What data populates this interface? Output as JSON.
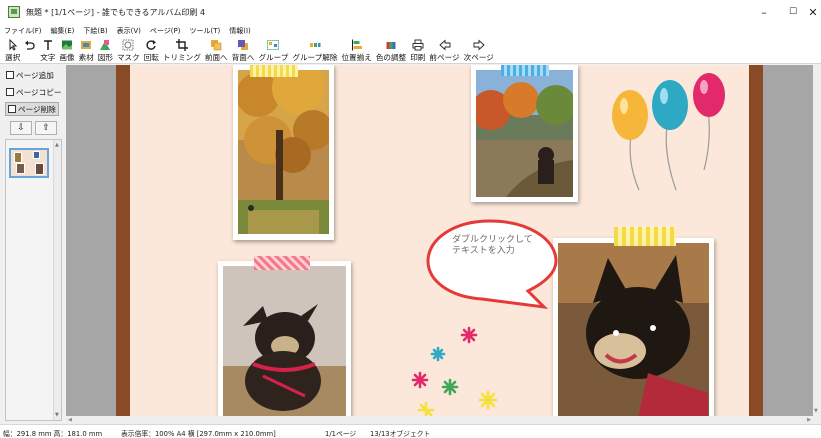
{
  "window": {
    "title": "無題 * [1/1ページ] - 誰でもできるアルバム印刷 4",
    "minimize": "–",
    "maximize": "☐",
    "close": "✕"
  },
  "menu": [
    "ファイル(F)",
    "編集(E)",
    "下絵(B)",
    "表示(V)",
    "ページ(P)",
    "ツール(T)",
    "情報(I)"
  ],
  "toolbar": [
    {
      "label": "選択",
      "icon": "cursor-icon"
    },
    {
      "label": "",
      "icon": "undo-icon"
    },
    {
      "label": "文字",
      "icon": "text-icon"
    },
    {
      "label": "画像",
      "icon": "image-icon"
    },
    {
      "label": "素材",
      "icon": "material-icon"
    },
    {
      "label": "図形",
      "icon": "shape-icon"
    },
    {
      "label": "マスク",
      "icon": "mask-icon"
    },
    {
      "label": "回転",
      "icon": "rotate-icon"
    },
    {
      "label": "トリミング",
      "icon": "trim-icon"
    },
    {
      "label": "前面へ",
      "icon": "bring-front-icon"
    },
    {
      "label": "背面へ",
      "icon": "send-back-icon"
    },
    {
      "label": "グループ",
      "icon": "group-icon"
    },
    {
      "label": "グループ解除",
      "icon": "ungroup-icon"
    },
    {
      "label": "位置揃え",
      "icon": "align-icon"
    },
    {
      "label": "色の調整",
      "icon": "color-adjust-icon"
    },
    {
      "label": "印刷",
      "icon": "print-icon"
    },
    {
      "label": "前ページ",
      "icon": "prev-page-icon"
    },
    {
      "label": "次ページ",
      "icon": "next-page-icon"
    }
  ],
  "side": {
    "add": "ページ追加",
    "copy": "ページコピー",
    "delete": "ページ削除",
    "down": "⇩",
    "up": "⇧"
  },
  "canvas": {
    "bubble_text": "ダブルクリックして\nテキストを入力"
  },
  "status": {
    "size": "幅：291.8 mm  高：181.0 mm",
    "zoom": "表示倍率：100%   A4 横 [297.0mm x 210.0mm]",
    "page": "1/1ページ",
    "objects": "13/13オブジェクト"
  },
  "colors": {
    "page_bg": "#fbe8da",
    "page_edge": "#8b4a26",
    "workspace": "#a6a6a6",
    "bubble_stroke": "#e43a3a"
  }
}
